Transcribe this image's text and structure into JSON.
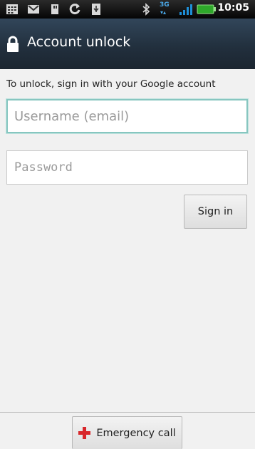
{
  "status_bar": {
    "time": "10:05",
    "network_label": "3G",
    "icons": [
      "calendar-icon",
      "gmail-icon",
      "sd-card-icon",
      "sync-icon",
      "usb-debug-icon",
      "bluetooth-icon",
      "data-icon",
      "signal-icon",
      "battery-icon"
    ]
  },
  "header": {
    "title": "Account unlock",
    "icon": "lock-icon"
  },
  "form": {
    "instruction": "To unlock, sign in with your Google account",
    "username_placeholder": "Username (email)",
    "password_placeholder": "Password",
    "sign_in_label": "Sign in"
  },
  "footer": {
    "emergency_label": "Emergency call",
    "emergency_icon": "red-cross-icon"
  },
  "colors": {
    "title_bar": "#2b3a4a",
    "focus_border": "#87c6c0",
    "emergency_cross": "#d8272b"
  }
}
